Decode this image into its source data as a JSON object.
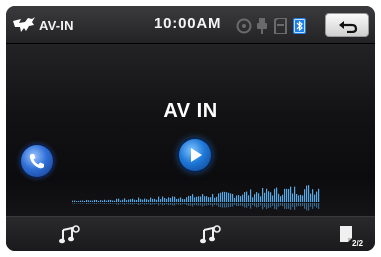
{
  "header": {
    "title": "AV-IN",
    "clock": "10:00AM",
    "status_icons": [
      "disc-icon",
      "usb-icon",
      "sd-card-icon",
      "bluetooth-icon"
    ],
    "back_icon": "back-arrow-icon"
  },
  "main": {
    "source_title": "AV IN"
  },
  "bottombar": {
    "buttons": [
      "music-note-icon",
      "music-note-icon",
      "page-icon"
    ],
    "page_indicator": "2/2"
  },
  "colors": {
    "accent_blue": "#2f7fe0",
    "wave_blue": "#5aa8e6",
    "background": "#121214"
  }
}
